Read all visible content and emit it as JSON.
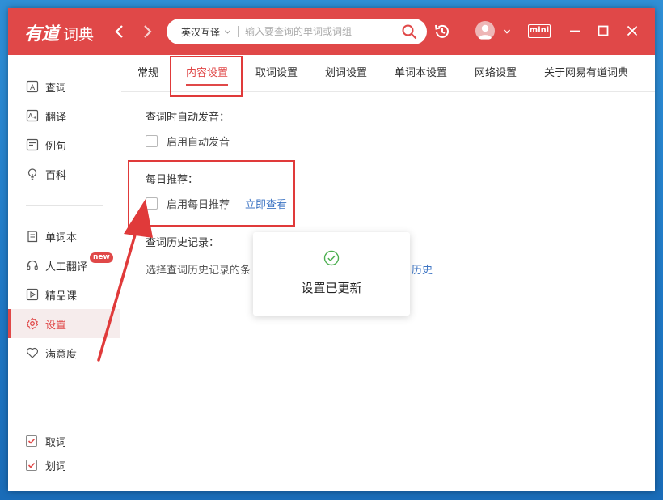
{
  "app": {
    "logo_mark": "有道",
    "logo_name": "词典"
  },
  "search": {
    "mode": "英汉互译",
    "placeholder": "输入要查询的单词或词组",
    "value": ""
  },
  "header": {
    "mini_label": "mini"
  },
  "sidebar": {
    "items": [
      {
        "label": "查词",
        "icon": "search-dict-icon"
      },
      {
        "label": "翻译",
        "icon": "translate-icon"
      },
      {
        "label": "例句",
        "icon": "example-icon"
      },
      {
        "label": "百科",
        "icon": "bulb-icon"
      },
      {
        "label": "单词本",
        "icon": "wordbook-icon"
      },
      {
        "label": "人工翻译",
        "icon": "headset-icon",
        "badge": "new"
      },
      {
        "label": "精品课",
        "icon": "course-icon"
      },
      {
        "label": "设置",
        "icon": "gear-icon",
        "active": true
      },
      {
        "label": "满意度",
        "icon": "heart-icon"
      }
    ],
    "toggles": [
      {
        "label": "取词",
        "checked": true
      },
      {
        "label": "划词",
        "checked": true
      }
    ]
  },
  "tabs": [
    "常规",
    "内容设置",
    "取词设置",
    "划词设置",
    "单词本设置",
    "网络设置",
    "关于网易有道词典"
  ],
  "active_tab": "内容设置",
  "content": {
    "auto_pronounce_title": "查词时自动发音：",
    "auto_pronounce_option": "启用自动发音",
    "daily_title": "每日推荐：",
    "daily_option": "启用每日推荐",
    "daily_link": "立即查看",
    "history_title": "查词历史记录：",
    "history_desc_visible": "选择查词历史记录的条",
    "history_link_visible": "历史"
  },
  "toast": {
    "message": "设置已更新"
  },
  "colors": {
    "brand": "#e04848",
    "link": "#3f76c4",
    "success": "#4caf50",
    "annotation": "#e03a3a"
  }
}
